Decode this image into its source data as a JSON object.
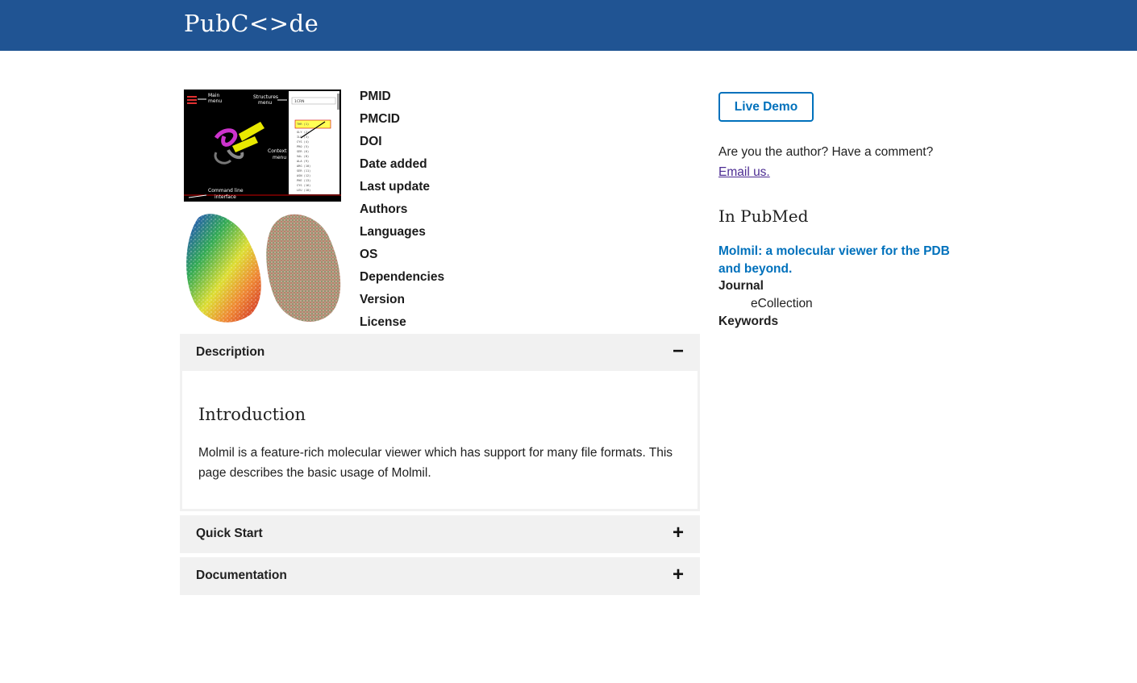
{
  "header": {
    "brand": "PubC<>de",
    "brand_color": "#205493"
  },
  "screenshots": {
    "main_labels": {
      "main_menu": "Main menu",
      "structures_menu": "Structures menu",
      "context_menu": "Context menu",
      "command_line": "Command line interface"
    }
  },
  "metadata_fields": [
    "PMID",
    "PMCID",
    "DOI",
    "Date added",
    "Last update",
    "Authors",
    "Languages",
    "OS",
    "Dependencies",
    "Version",
    "License"
  ],
  "sections": {
    "description": {
      "label": "Description",
      "toggle": "−",
      "expanded": true
    },
    "quick_start": {
      "label": "Quick Start",
      "toggle": "+",
      "expanded": false
    },
    "documentation": {
      "label": "Documentation",
      "toggle": "+",
      "expanded": false
    }
  },
  "description": {
    "heading": "Introduction",
    "text": "Molmil is a feature-rich molecular viewer which has support for many file formats. This page describes the basic usage of Molmil."
  },
  "sidebar": {
    "live_demo": "Live Demo",
    "author_question": "Are you the author? Have a comment?",
    "email_link": "Email us.",
    "pubmed_heading": "In PubMed",
    "pub_title": "Molmil: a molecular viewer for the PDB and beyond.",
    "journal_label": "Journal",
    "journal_value": "eCollection",
    "keywords_label": "Keywords"
  },
  "colors": {
    "accent": "#0071bc",
    "visited_link": "#4c2c92",
    "panel_bg": "#f1f1f1"
  }
}
